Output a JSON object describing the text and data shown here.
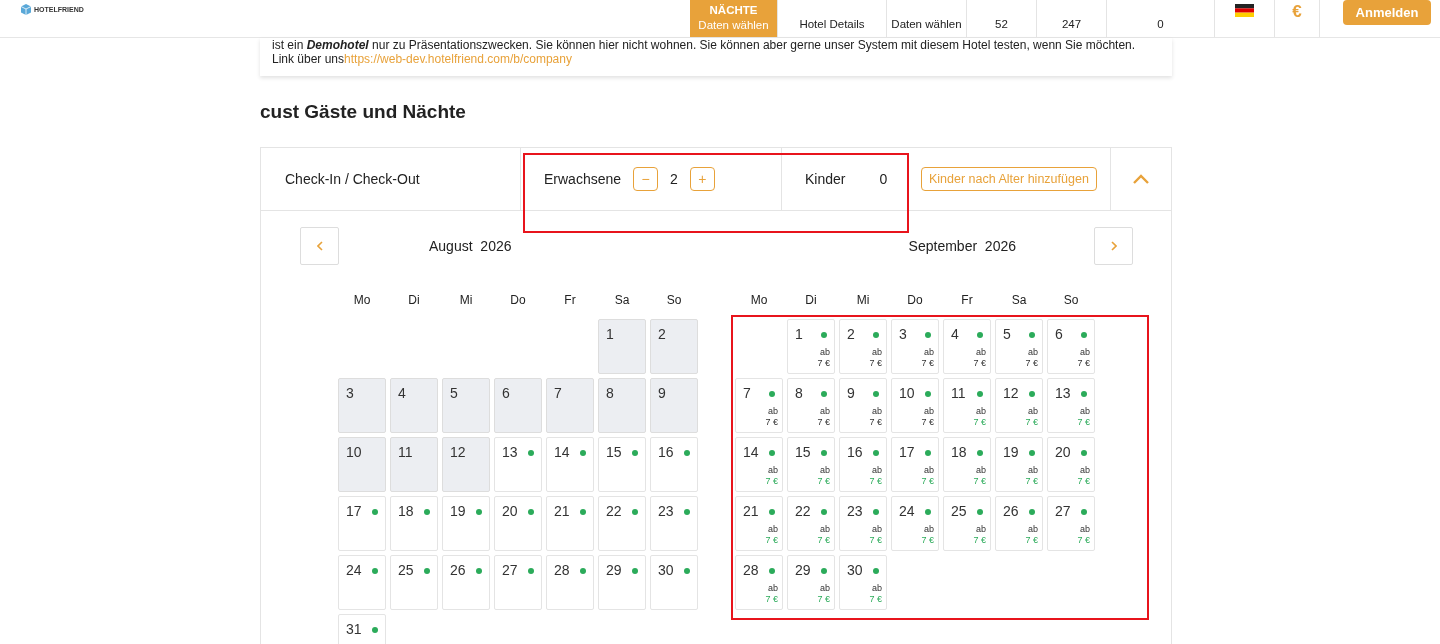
{
  "header": {
    "logo_text": "HOTELFRIEND",
    "nav": [
      {
        "kind": "step",
        "title": "NÄCHTE",
        "subtitle": "Daten wählen",
        "selected": true
      },
      {
        "kind": "plain",
        "title": "Hotel Details",
        "selected": false
      },
      {
        "kind": "plain",
        "title": "Daten wählen",
        "selected": false
      },
      {
        "kind": "number",
        "title": "52",
        "selected": false
      },
      {
        "kind": "number",
        "title": "247",
        "selected": false
      },
      {
        "kind": "wide",
        "title": "0",
        "selected": false
      },
      {
        "kind": "flag",
        "selected": false
      },
      {
        "kind": "currency",
        "title": "€",
        "selected": false
      }
    ],
    "login_button": "Anmelden"
  },
  "info": {
    "text": "ist ein **Demohotel** nur zu Präsentationszwecken. Sie können hier nicht wohnen. Sie können aber gerne unser System mit diesem Hotel testen, wenn Sie möchten.",
    "link_prefix": "Link über uns",
    "link": "https://web-dev.hotelfriend.com/b/company"
  },
  "heading": "cust Gäste und Nächte",
  "booking": {
    "checkin_label": "Check-In / Check-Out",
    "adults_label": "Erwachsene",
    "adults": "2",
    "minus": "−",
    "plus": "+",
    "children_label": "Kinder",
    "children": "0",
    "add_children_button": "Kinder nach Alter hinzufügen",
    "expanded": true
  },
  "calendar": {
    "months": [
      {
        "title": "August  2026",
        "weekdays": [
          "Mo",
          "Di",
          "Mi",
          "Do",
          "Fr",
          "Sa",
          "So"
        ],
        "days": [
          {
            "kind": "blank"
          },
          {
            "kind": "blank"
          },
          {
            "kind": "blank"
          },
          {
            "kind": "blank"
          },
          {
            "kind": "blank"
          },
          {
            "kind": "day",
            "day": "1",
            "disabled": true,
            "available": false
          },
          {
            "kind": "day",
            "day": "2",
            "disabled": true,
            "available": false
          },
          {
            "kind": "day",
            "day": "3",
            "disabled": true,
            "available": false
          },
          {
            "kind": "day",
            "day": "4",
            "disabled": true,
            "available": false
          },
          {
            "kind": "day",
            "day": "5",
            "disabled": true,
            "available": false
          },
          {
            "kind": "day",
            "day": "6",
            "disabled": true,
            "available": false
          },
          {
            "kind": "day",
            "day": "7",
            "disabled": true,
            "available": false
          },
          {
            "kind": "day",
            "day": "8",
            "disabled": true,
            "available": false
          },
          {
            "kind": "day",
            "day": "9",
            "disabled": true,
            "available": false
          },
          {
            "kind": "day",
            "day": "10",
            "disabled": true,
            "available": false
          },
          {
            "kind": "day",
            "day": "11",
            "disabled": true,
            "available": false
          },
          {
            "kind": "day",
            "day": "12",
            "disabled": true,
            "available": false
          },
          {
            "kind": "day",
            "day": "13",
            "disabled": false,
            "available": true
          },
          {
            "kind": "day",
            "day": "14",
            "disabled": false,
            "available": true
          },
          {
            "kind": "day",
            "day": "15",
            "disabled": false,
            "available": true
          },
          {
            "kind": "day",
            "day": "16",
            "disabled": false,
            "available": true
          },
          {
            "kind": "day",
            "day": "17",
            "disabled": false,
            "available": true
          },
          {
            "kind": "day",
            "day": "18",
            "disabled": false,
            "available": true
          },
          {
            "kind": "day",
            "day": "19",
            "disabled": false,
            "available": true
          },
          {
            "kind": "day",
            "day": "20",
            "disabled": false,
            "available": true
          },
          {
            "kind": "day",
            "day": "21",
            "disabled": false,
            "available": true
          },
          {
            "kind": "day",
            "day": "22",
            "disabled": false,
            "available": true
          },
          {
            "kind": "day",
            "day": "23",
            "disabled": false,
            "available": true
          },
          {
            "kind": "day",
            "day": "24",
            "disabled": false,
            "available": true
          },
          {
            "kind": "day",
            "day": "25",
            "disabled": false,
            "available": true
          },
          {
            "kind": "day",
            "day": "26",
            "disabled": false,
            "available": true
          },
          {
            "kind": "day",
            "day": "27",
            "disabled": false,
            "available": true
          },
          {
            "kind": "day",
            "day": "28",
            "disabled": false,
            "available": true
          },
          {
            "kind": "day",
            "day": "29",
            "disabled": false,
            "available": true
          },
          {
            "kind": "day",
            "day": "30",
            "disabled": false,
            "available": true
          },
          {
            "kind": "day",
            "day": "31",
            "disabled": false,
            "available": true
          }
        ]
      },
      {
        "title": "September  2026",
        "weekdays": [
          "Mo",
          "Di",
          "Mi",
          "Do",
          "Fr",
          "Sa",
          "So"
        ],
        "framed": true,
        "days": [
          {
            "kind": "blank"
          },
          {
            "kind": "day",
            "day": "1",
            "disabled": false,
            "available": true,
            "from": "ab",
            "price": "7 €",
            "price_highlighted": false
          },
          {
            "kind": "day",
            "day": "2",
            "disabled": false,
            "available": true,
            "from": "ab",
            "price": "7 €",
            "price_highlighted": false
          },
          {
            "kind": "day",
            "day": "3",
            "disabled": false,
            "available": true,
            "from": "ab",
            "price": "7 €",
            "price_highlighted": false
          },
          {
            "kind": "day",
            "day": "4",
            "disabled": false,
            "available": true,
            "from": "ab",
            "price": "7 €",
            "price_highlighted": false
          },
          {
            "kind": "day",
            "day": "5",
            "disabled": false,
            "available": true,
            "from": "ab",
            "price": "7 €",
            "price_highlighted": false
          },
          {
            "kind": "day",
            "day": "6",
            "disabled": false,
            "available": true,
            "from": "ab",
            "price": "7 €",
            "price_highlighted": false
          },
          {
            "kind": "day",
            "day": "7",
            "disabled": false,
            "available": true,
            "from": "ab",
            "price": "7 €",
            "price_highlighted": false
          },
          {
            "kind": "day",
            "day": "8",
            "disabled": false,
            "available": true,
            "from": "ab",
            "price": "7 €",
            "price_highlighted": false
          },
          {
            "kind": "day",
            "day": "9",
            "disabled": false,
            "available": true,
            "from": "ab",
            "price": "7 €",
            "price_highlighted": false
          },
          {
            "kind": "day",
            "day": "10",
            "disabled": false,
            "available": true,
            "from": "ab",
            "price": "7 €",
            "price_highlighted": false
          },
          {
            "kind": "day",
            "day": "11",
            "disabled": false,
            "available": true,
            "from": "ab",
            "price": "7 €",
            "price_highlighted": true
          },
          {
            "kind": "day",
            "day": "12",
            "disabled": false,
            "available": true,
            "from": "ab",
            "price": "7 €",
            "price_highlighted": true
          },
          {
            "kind": "day",
            "day": "13",
            "disabled": false,
            "available": true,
            "from": "ab",
            "price": "7 €",
            "price_highlighted": true
          },
          {
            "kind": "day",
            "day": "14",
            "disabled": false,
            "available": true,
            "from": "ab",
            "price": "7 €",
            "price_highlighted": true
          },
          {
            "kind": "day",
            "day": "15",
            "disabled": false,
            "available": true,
            "from": "ab",
            "price": "7 €",
            "price_highlighted": true
          },
          {
            "kind": "day",
            "day": "16",
            "disabled": false,
            "available": true,
            "from": "ab",
            "price": "7 €",
            "price_highlighted": true
          },
          {
            "kind": "day",
            "day": "17",
            "disabled": false,
            "available": true,
            "from": "ab",
            "price": "7 €",
            "price_highlighted": true
          },
          {
            "kind": "day",
            "day": "18",
            "disabled": false,
            "available": true,
            "from": "ab",
            "price": "7 €",
            "price_highlighted": true
          },
          {
            "kind": "day",
            "day": "19",
            "disabled": false,
            "available": true,
            "from": "ab",
            "price": "7 €",
            "price_highlighted": true
          },
          {
            "kind": "day",
            "day": "20",
            "disabled": false,
            "available": true,
            "from": "ab",
            "price": "7 €",
            "price_highlighted": true
          },
          {
            "kind": "day",
            "day": "21",
            "disabled": false,
            "available": true,
            "from": "ab",
            "price": "7 €",
            "price_highlighted": true
          },
          {
            "kind": "day",
            "day": "22",
            "disabled": false,
            "available": true,
            "from": "ab",
            "price": "7 €",
            "price_highlighted": true
          },
          {
            "kind": "day",
            "day": "23",
            "disabled": false,
            "available": true,
            "from": "ab",
            "price": "7 €",
            "price_highlighted": true
          },
          {
            "kind": "day",
            "day": "24",
            "disabled": false,
            "available": true,
            "from": "ab",
            "price": "7 €",
            "price_highlighted": true
          },
          {
            "kind": "day",
            "day": "25",
            "disabled": false,
            "available": true,
            "from": "ab",
            "price": "7 €",
            "price_highlighted": true
          },
          {
            "kind": "day",
            "day": "26",
            "disabled": false,
            "available": true,
            "from": "ab",
            "price": "7 €",
            "price_highlighted": true
          },
          {
            "kind": "day",
            "day": "27",
            "disabled": false,
            "available": true,
            "from": "ab",
            "price": "7 €",
            "price_highlighted": true
          },
          {
            "kind": "day",
            "day": "28",
            "disabled": false,
            "available": true,
            "from": "ab",
            "price": "7 €",
            "price_highlighted": true
          },
          {
            "kind": "day",
            "day": "29",
            "disabled": false,
            "available": true,
            "from": "ab",
            "price": "7 €",
            "price_highlighted": true
          },
          {
            "kind": "day",
            "day": "30",
            "disabled": false,
            "available": true,
            "from": "ab",
            "price": "7 €",
            "price_highlighted": true
          }
        ]
      }
    ]
  }
}
